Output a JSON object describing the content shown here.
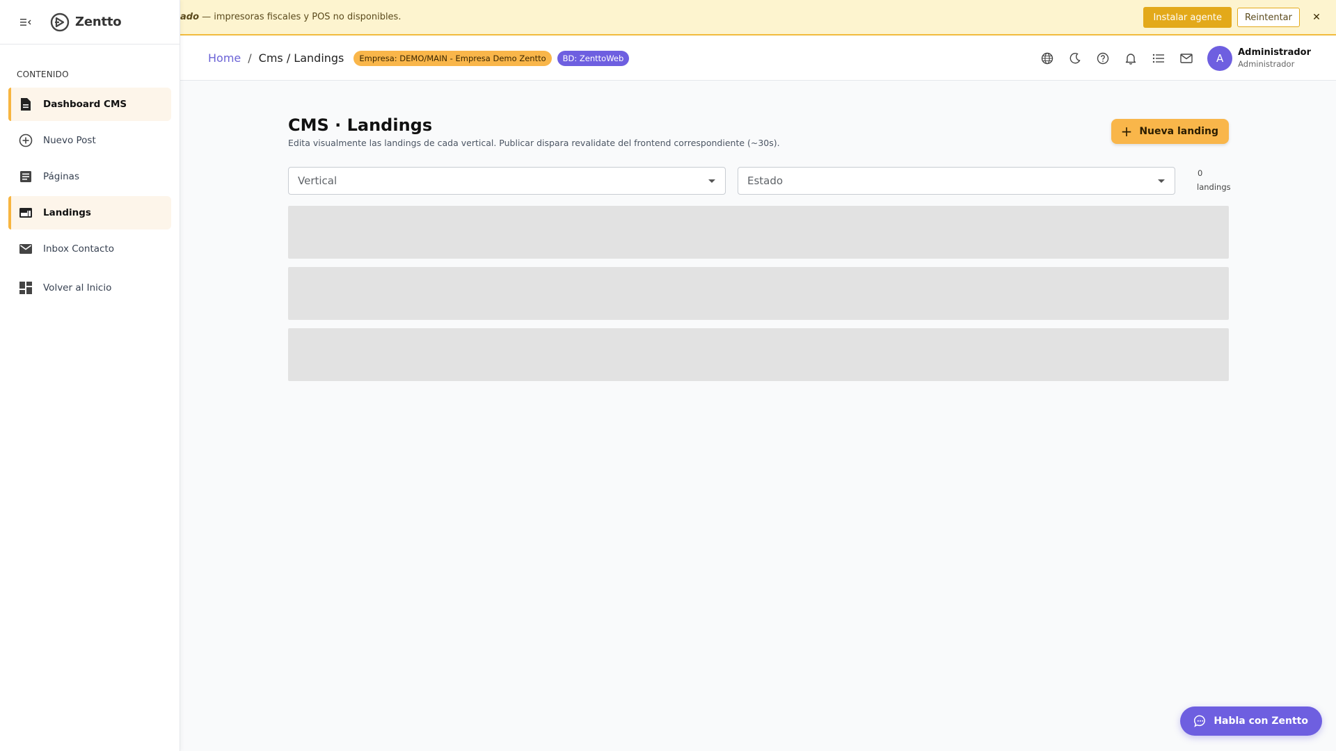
{
  "sidebar": {
    "brand": "Zentto",
    "section_label": "CONTENIDO",
    "items": [
      {
        "label": "Dashboard CMS"
      },
      {
        "label": "Nuevo Post"
      },
      {
        "label": "Páginas"
      },
      {
        "label": "Landings"
      },
      {
        "label": "Inbox Contacto"
      },
      {
        "label": "Volver al Inicio"
      }
    ]
  },
  "banner": {
    "lead": "ado",
    "message": " — impresoras fiscales y POS no disponibles.",
    "install_label": "Instalar agente",
    "retry_label": "Reintentar",
    "close_label": "✕"
  },
  "header": {
    "breadcrumb_home": "Home",
    "breadcrumb_sep": "/",
    "breadcrumb_current": "Cms / Landings",
    "empresa_chip": "Empresa: DEMO/MAIN - Empresa Demo Zentto",
    "bd_chip": "BD: ZenttoWeb",
    "user_initial": "A",
    "user_name": "Administrador",
    "user_role": "Administrador"
  },
  "main": {
    "title": "CMS · Landings",
    "subtitle": "Edita visualmente las landings de cada vertical. Publicar dispara revalidate del frontend correspondiente (~30s).",
    "new_button_label": "Nueva landing",
    "filter_vertical_placeholder": "Vertical",
    "filter_estado_placeholder": "Estado",
    "count_value": "0",
    "count_unit": "landings"
  },
  "chat": {
    "label": "Habla con Zentto"
  },
  "colors": {
    "accent_orange": "#f9b64a",
    "accent_purple": "#6e5fe0",
    "banner_bg": "#fdf4cf",
    "active_item_bg": "#fdf5ea"
  }
}
